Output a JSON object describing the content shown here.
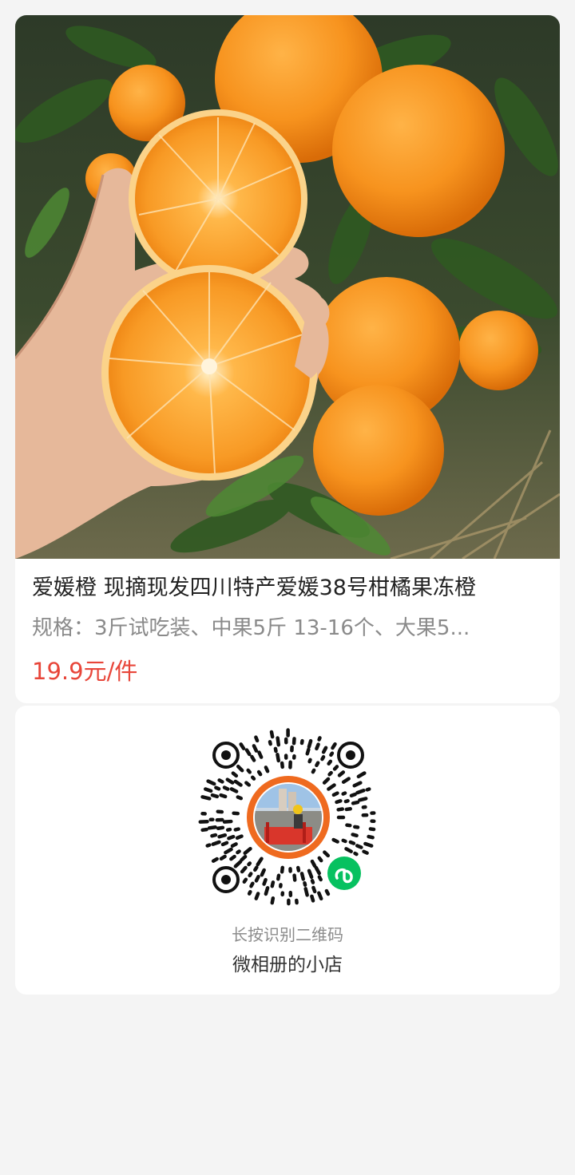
{
  "product": {
    "image_alt": "hand holding a halved orange in front of an orange tree",
    "title": "爱媛橙 现摘现发四川特产爱媛38号柑橘果冻橙",
    "spec": "规格：3斤试吃装、中果5斤 13-16个、大果5...",
    "price": "19.9元/件"
  },
  "qr": {
    "hint": "长按识别二维码",
    "shop_name": "微相册的小店",
    "badge_icon": "wechat-miniprogram-icon",
    "accent_color": "#07c160",
    "ring_color": "#ef6a1f"
  }
}
